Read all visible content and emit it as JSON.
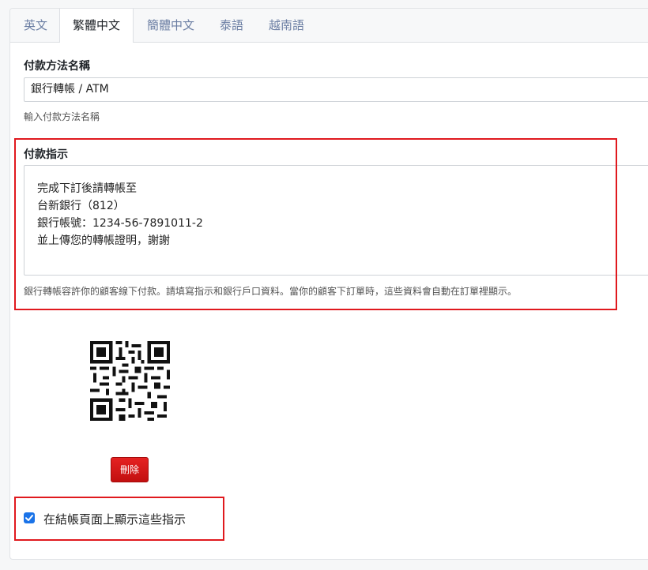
{
  "tabs": [
    {
      "label": "英文"
    },
    {
      "label": "繁體中文"
    },
    {
      "label": "簡體中文"
    },
    {
      "label": "泰語"
    },
    {
      "label": "越南語"
    }
  ],
  "active_tab": "繁體中文",
  "payment_name": {
    "label": "付款方法名稱",
    "value": "銀行轉帳 / ATM",
    "help": "輸入付款方法名稱"
  },
  "payment_instructions": {
    "label": "付款指示",
    "lines": [
      "完成下訂後請轉帳至",
      "台新銀行（812）",
      "銀行帳號：1234-56-7891011-2",
      "並上傳您的轉帳證明，謝謝"
    ],
    "help": "銀行轉帳容許你的顧客線下付款。請填寫指示和銀行戶口資料。當你的顧客下訂單時，這些資料會自動在訂單裡顯示。"
  },
  "qr_code": {
    "icon": "qr-code-image"
  },
  "delete_button": {
    "label": "刪除",
    "color": "#d81414"
  },
  "show_on_checkout": {
    "checked": true,
    "label": "在結帳頁面上顯示這些指示"
  },
  "colors": {
    "highlight_box": "#e0191e",
    "checkbox": "#1a73e8",
    "tab_inactive": "#6b7ea3"
  }
}
